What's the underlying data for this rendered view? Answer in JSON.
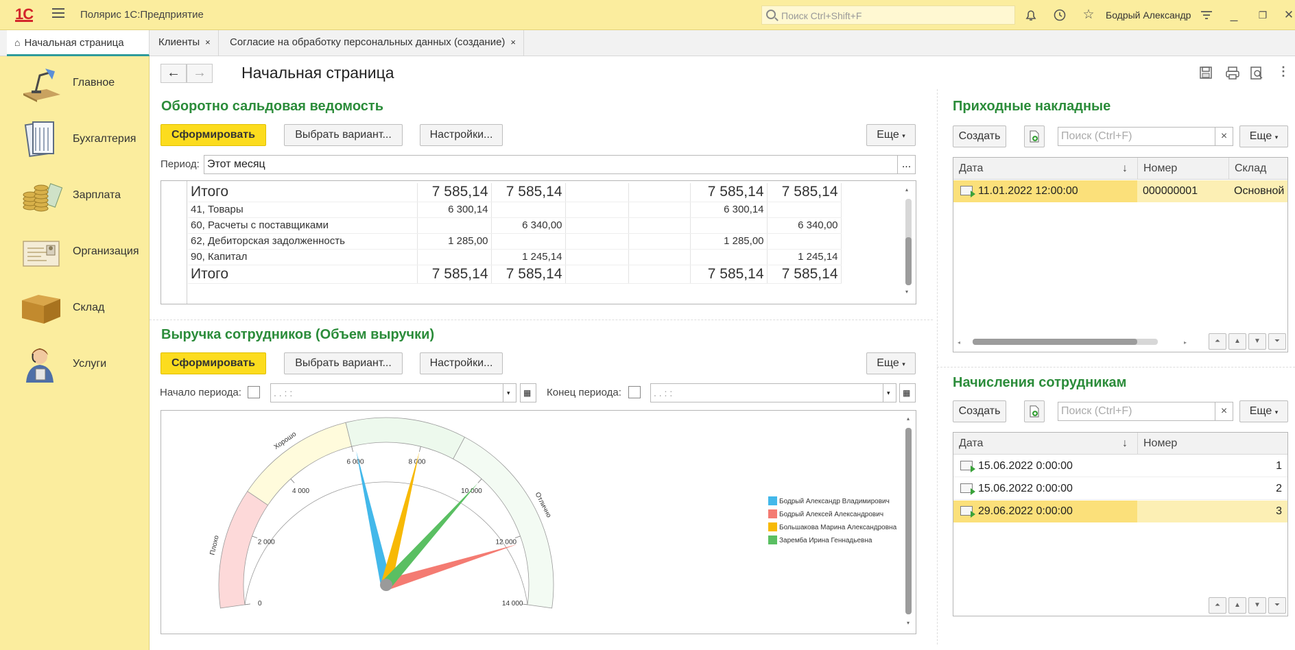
{
  "app": {
    "title": "Полярис 1С:Предприятие",
    "logo": "1С",
    "search_placeholder": "Поиск Ctrl+Shift+F",
    "user": "Бодрый Александр"
  },
  "tabs": [
    {
      "label": "Начальная страница"
    },
    {
      "label": "Клиенты",
      "close": "×"
    },
    {
      "label": "Согласие на обработку персональных данных (создание)",
      "close": "×"
    }
  ],
  "sidebar": {
    "items": [
      {
        "label": "Главное",
        "icon": "desk-lamp-icon"
      },
      {
        "label": "Бухгалтерия",
        "icon": "ledger-icon"
      },
      {
        "label": "Зарплата",
        "icon": "coins-icon"
      },
      {
        "label": "Организация",
        "icon": "certificate-icon"
      },
      {
        "label": "Склад",
        "icon": "box-icon"
      },
      {
        "label": "Услуги",
        "icon": "consultant-icon"
      }
    ]
  },
  "page": {
    "title": "Начальная страница",
    "back": "←",
    "forward": "→"
  },
  "osv": {
    "title": "Оборотно сальдовая ведомость",
    "generate": "Сформировать",
    "variant": "Выбрать вариант...",
    "settings": "Настройки...",
    "more": "Еще",
    "period_label": "Период:",
    "period_value": "Этот месяц",
    "period_btn": "...",
    "rows": [
      {
        "name": "Итого",
        "c1": "7 585,14",
        "c2": "7 585,14",
        "c3": "",
        "c4": "",
        "c5": "7 585,14",
        "c6": "7 585,14",
        "big": true
      },
      {
        "name": "41, Товары",
        "c1": "6 300,14",
        "c2": "",
        "c3": "",
        "c4": "",
        "c5": "6 300,14",
        "c6": ""
      },
      {
        "name": "60, Расчеты с поставщиками",
        "c1": "",
        "c2": "6 340,00",
        "c3": "",
        "c4": "",
        "c5": "",
        "c6": "6 340,00"
      },
      {
        "name": "62, Дебиторская задолженность",
        "c1": "1 285,00",
        "c2": "",
        "c3": "",
        "c4": "",
        "c5": "1 285,00",
        "c6": ""
      },
      {
        "name": "90, Капитал",
        "c1": "",
        "c2": "1 245,14",
        "c3": "",
        "c4": "",
        "c5": "",
        "c6": "1 245,14"
      },
      {
        "name": "Итого",
        "c1": "7 585,14",
        "c2": "7 585,14",
        "c3": "",
        "c4": "",
        "c5": "7 585,14",
        "c6": "7 585,14",
        "big": true
      }
    ]
  },
  "revenue": {
    "title": "Выручка сотрудников (Объем выручки)",
    "generate": "Сформировать",
    "variant": "Выбрать вариант...",
    "settings": "Настройки...",
    "more": "Еще",
    "start_label": "Начало периода:",
    "start_value": " .  .     : :",
    "end_label": "Конец периода:",
    "end_value": " .  .     : :"
  },
  "chart_data": {
    "type": "gauge",
    "min": 0,
    "max": 14000,
    "ticks": [
      "0",
      "2 000",
      "4 000",
      "6 000",
      "8 000",
      "10 000",
      "12 000",
      "14 000"
    ],
    "bands": [
      {
        "label": "Плохо",
        "from": 0,
        "to": 3000,
        "color": "#fdd9d9"
      },
      {
        "label": "Хорошо",
        "from": 3000,
        "to": 6000,
        "color": "#fffbdc"
      },
      {
        "label": "",
        "from": 6000,
        "to": 9000,
        "color": "#edf9ed"
      },
      {
        "label": "Отлично",
        "from": 9000,
        "to": 14000,
        "color": "#f3fbf3"
      }
    ],
    "series": [
      {
        "name": "Бодрый Александр Владимирович",
        "value": 6100,
        "color": "#43b8ea"
      },
      {
        "name": "Бодрый Алексей Александрович",
        "value": 12200,
        "color": "#f47b72"
      },
      {
        "name": "Большакова Марина Александровна",
        "value": 8000,
        "color": "#f7b905"
      },
      {
        "name": "Заремба Ирина Геннадьевна",
        "value": 10000,
        "color": "#5abf62"
      }
    ]
  },
  "invoices": {
    "title": "Приходные накладные",
    "create": "Создать",
    "search_placeholder": "Поиск (Ctrl+F)",
    "clear": "×",
    "more": "Еще",
    "columns": [
      "Дата",
      "Номер",
      "Склад"
    ],
    "sort": "↓",
    "rows": [
      {
        "date": "11.01.2022 12:00:00",
        "number": "000000001",
        "warehouse": "Основной"
      }
    ]
  },
  "accruals": {
    "title": "Начисления сотрудникам",
    "create": "Создать",
    "search_placeholder": "Поиск (Ctrl+F)",
    "clear": "×",
    "more": "Еще",
    "columns": [
      "Дата",
      "Номер"
    ],
    "sort": "↓",
    "rows": [
      {
        "date": "15.06.2022 0:00:00",
        "number": "1"
      },
      {
        "date": "15.06.2022 0:00:00",
        "number": "2"
      },
      {
        "date": "29.06.2022 0:00:00",
        "number": "3"
      }
    ]
  }
}
